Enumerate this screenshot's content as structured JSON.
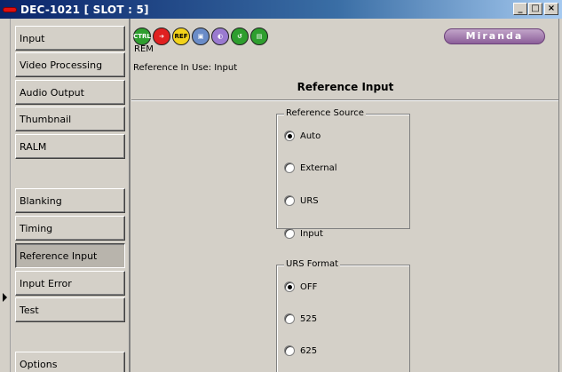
{
  "window": {
    "title": "DEC-1021 [ SLOT : 5]",
    "controls": {
      "minimize": "_",
      "maximize": "□",
      "close": "×"
    }
  },
  "sidebar": {
    "items": [
      {
        "label": "Input",
        "active": false
      },
      {
        "label": "Video Processing",
        "active": false
      },
      {
        "label": "Audio Output",
        "active": false
      },
      {
        "label": "Thumbnail",
        "active": false
      },
      {
        "label": "RALM",
        "active": false
      },
      {
        "label": "Blanking",
        "active": false
      },
      {
        "label": "Timing",
        "active": false
      },
      {
        "label": "Reference Input",
        "active": true
      },
      {
        "label": "Input Error",
        "active": false
      },
      {
        "label": "Test",
        "active": false
      },
      {
        "label": "Options",
        "active": false
      }
    ]
  },
  "toolbar": {
    "icons": [
      {
        "name": "ctrl-icon",
        "text": "CTRL",
        "color": "#2e9e2e"
      },
      {
        "name": "arrow-icon",
        "text": "➔",
        "color": "#e02020"
      },
      {
        "name": "ref-icon",
        "text": "REF",
        "color": "#f2d21a"
      },
      {
        "name": "monitor-icon",
        "text": "▣",
        "color": "#6a8cc8"
      },
      {
        "name": "audio-icon",
        "text": "◐",
        "color": "#9a7ad0"
      },
      {
        "name": "loop-icon",
        "text": "↺",
        "color": "#2e9e2e"
      },
      {
        "name": "layers-icon",
        "text": "▤",
        "color": "#2e9e2e"
      }
    ],
    "rem_label": "REM",
    "logo_text": "Miranda",
    "logo_color": "#8c5f99"
  },
  "status": {
    "reference_in_use": "Reference In Use: Input"
  },
  "main": {
    "title": "Reference Input",
    "reference_source": {
      "legend": "Reference Source",
      "options": [
        "Auto",
        "External",
        "URS",
        "Input"
      ],
      "selected": "Auto"
    },
    "urs_format": {
      "legend": "URS Format",
      "options": [
        "OFF",
        "525",
        "625"
      ],
      "selected": "OFF"
    }
  }
}
